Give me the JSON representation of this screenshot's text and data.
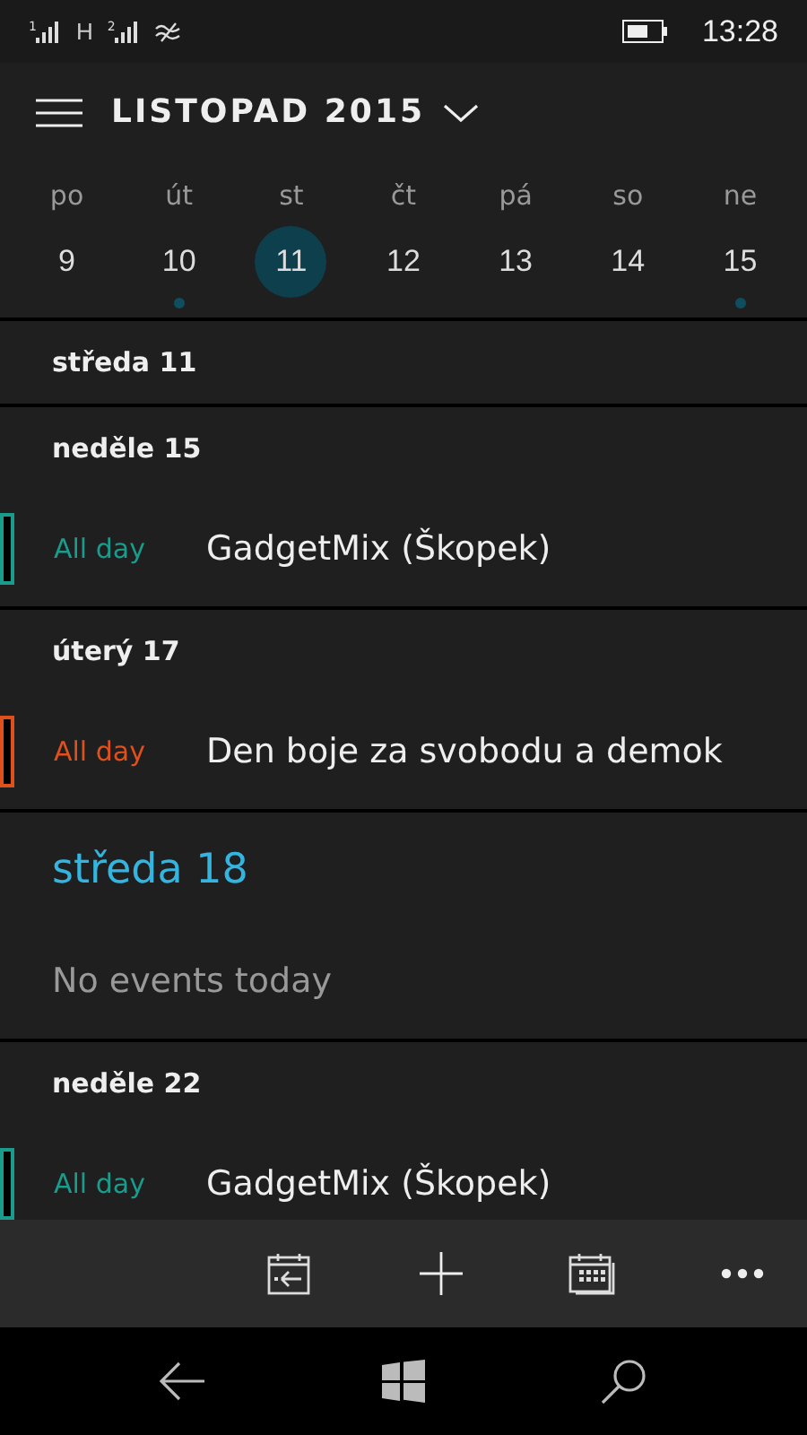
{
  "status_bar": {
    "sim1": "1",
    "network": "H",
    "sim2": "2",
    "time": "13:28"
  },
  "header": {
    "title": "LISTOPAD 2015"
  },
  "week": [
    {
      "label": "po",
      "date": "9",
      "selected": false,
      "has_events": false
    },
    {
      "label": "út",
      "date": "10",
      "selected": false,
      "has_events": true
    },
    {
      "label": "st",
      "date": "11",
      "selected": true,
      "has_events": false
    },
    {
      "label": "čt",
      "date": "12",
      "selected": false,
      "has_events": false
    },
    {
      "label": "pá",
      "date": "13",
      "selected": false,
      "has_events": false
    },
    {
      "label": "so",
      "date": "14",
      "selected": false,
      "has_events": false
    },
    {
      "label": "ne",
      "date": "15",
      "selected": false,
      "has_events": true
    }
  ],
  "agenda": [
    {
      "title": "středa 11",
      "today": false
    },
    {
      "title": "neděle 15",
      "today": false,
      "events": [
        {
          "time": "All day",
          "title": "GadgetMix (Škopek)",
          "color": "#1a9c8c"
        }
      ]
    },
    {
      "title": "úterý 17",
      "today": false,
      "events": [
        {
          "time": "All day",
          "title": "Den boje za svobodu a demok",
          "color": "#e0501c"
        }
      ]
    },
    {
      "title": "středa 18",
      "today": true,
      "message": "No events today"
    },
    {
      "title": "neděle 22",
      "today": false,
      "events": [
        {
          "time": "All day",
          "title": "GadgetMix (Škopek)",
          "color": "#1a9c8c"
        }
      ]
    }
  ]
}
